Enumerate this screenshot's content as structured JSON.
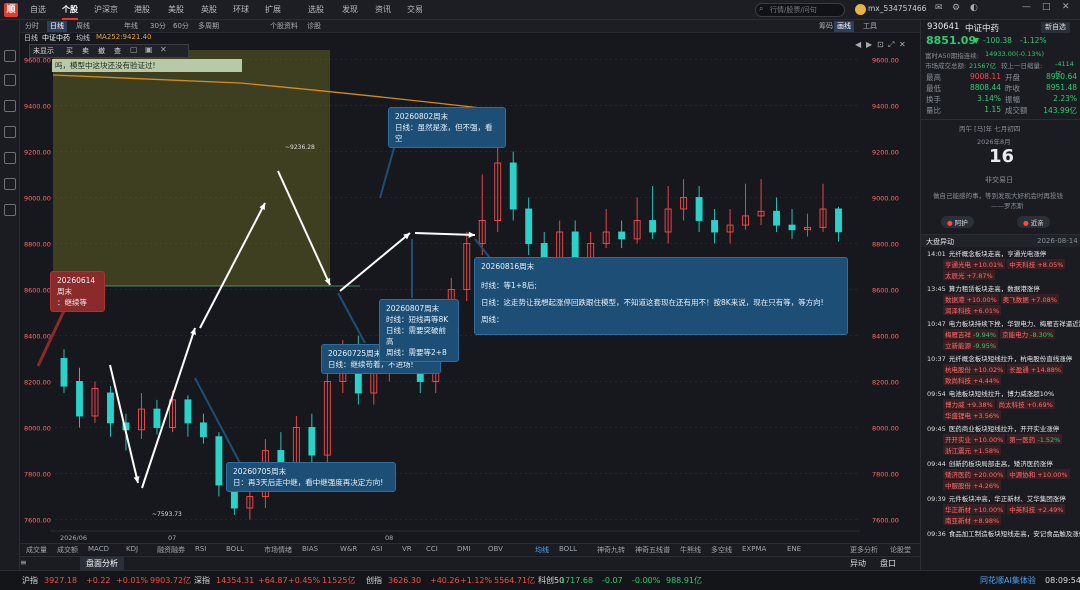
{
  "topnav": {
    "items": [
      "自选",
      "个股",
      "沪深京",
      "港股",
      "美股",
      "英股",
      "环球",
      "扩展",
      "选股",
      "发现",
      "资讯",
      "交易"
    ],
    "active": 1,
    "search_placeholder": "行情/股票/问句",
    "user": "mx_534757466"
  },
  "tb2": {
    "items": [
      "分时",
      "日线",
      "周线",
      "年线",
      "30分",
      "60分",
      "多周期",
      "个股资料",
      "诊股"
    ],
    "active": 1,
    "right": [
      "筹码",
      "画线",
      "工具"
    ]
  },
  "tb3": {
    "label1": "日线",
    "label2": "中证中药",
    "label3": "均线",
    "ma": "MA252:9421.40"
  },
  "draw_toolbar": [
    "未显示",
    "买",
    "卖",
    "撤",
    "查"
  ],
  "top_note": "吗，模型中这块还没有验证过!",
  "yaxis": [
    "9600.00",
    "9400.00",
    "9200.00",
    "9000.00",
    "8800.00",
    "8600.00",
    "8400.00",
    "8200.00",
    "8000.00",
    "7800.00",
    "7600.00"
  ],
  "xaxis": [
    "2026/06",
    "07",
    "08"
  ],
  "high_label": "~9236.28",
  "low_label": "~7593.73",
  "notes": {
    "n1": {
      "title": "20260614周末",
      "line": "：继续等"
    },
    "n2": {
      "title": "20260705周末",
      "line": "日：再3天后走中继，看中继强度再决定方向!"
    },
    "n3": {
      "title": "20260725周末",
      "line": "日线：继续苟着，不进场!"
    },
    "n4": {
      "title": "20260802周末",
      "line": "日线：虽然是涨，但不强，看空"
    },
    "n5": {
      "title": "20260807周末",
      "l1": "时线：短线再等8K",
      "l2": "日线：需要突破前高",
      "l3": "周线：需要等2+8"
    },
    "n6": {
      "title": "20260816周末",
      "l1": "时线：等1+8后;",
      "l2": "日线：这走势让我想起涨停回跌跟住模型，不知道这套现在还有用不！按8K来说，现在只有等，等方向!",
      "l3": "周线："
    }
  },
  "indicators": [
    "成交量",
    "成交额",
    "MACD",
    "KDJ",
    "融资融券",
    "RSI",
    "BOLL",
    "市场情绪",
    "BIAS",
    "W&R",
    "ASI",
    "VR",
    "CCI",
    "DMI",
    "OBV"
  ],
  "ind2": [
    "均线",
    "BOLL",
    "神奇九转",
    "神奇五线谱",
    "牛熊线",
    "多空线",
    "EXPMA",
    "ENE"
  ],
  "ind_right": [
    "更多分析",
    "论股堂"
  ],
  "panel": {
    "code": "930641",
    "name": "中证中药",
    "btn": "新自选",
    "price": "8851.09",
    "arrow": "▼",
    "chg": "-100.38",
    "pct": "-1.12%",
    "r1l": "富时A50期指连续:",
    "r1v": "14933.00(-0.13%)",
    "r2l": "市场成交总额:",
    "r2v": "21567亿",
    "r2l2": "较上一日缩量:",
    "r2v2": "-4114亿",
    "stats": [
      [
        "最高",
        "9008.11",
        "开盘",
        "8920.64"
      ],
      [
        "最低",
        "8808.44",
        "昨收",
        "8951.48"
      ],
      [
        "换手",
        "3.14%",
        "振幅",
        "2.23%"
      ],
      [
        "量比",
        "1.15",
        "成交额",
        "143.99亿"
      ]
    ],
    "cal_head": "丙午 [马]年 七月初四",
    "cal_month": "2026年8月",
    "cal_day": "16",
    "cal_status": "非交易日",
    "quote": "做自己能感的事，等到发现大好机会时再投钱",
    "author": "——罗杰斯",
    "btn_a": "阿护",
    "btn_b": "近亲",
    "news_head": "大盘异动",
    "news_date": "2026-08-14",
    "news": [
      {
        "t": "14:01",
        "h": "光纤概念板块走高，亨通光电涨停",
        "s": [
          [
            "亨通光电",
            "+10.01%"
          ],
          [
            "中天科技",
            "+8.05%"
          ],
          [
            "太辰光",
            "+7.87%"
          ]
        ]
      },
      {
        "t": "13:45",
        "h": "算力租赁板块走高，数据港涨停",
        "s": [
          [
            "数据港",
            "+10.00%"
          ],
          [
            "奥飞数据",
            "+7.08%"
          ],
          [
            "润泽科技",
            "+6.01%"
          ]
        ]
      },
      {
        "t": "10:47",
        "h": "电力板块持续下挫，华银电力、梅雁吉祥逼近跌停",
        "s": [
          [
            "梅雁吉祥",
            "-9.94%"
          ],
          [
            "京能电力",
            "-8.30%"
          ],
          [
            "立新能源",
            "-9.95%"
          ]
        ]
      },
      {
        "t": "10:37",
        "h": "光纤概念板块短线拉升，杭电股份直线涨停",
        "s": [
          [
            "杭电股份",
            "+10.02%"
          ],
          [
            "长盈通",
            "+14.88%"
          ],
          [
            "致尚科技",
            "+4.44%"
          ]
        ]
      },
      {
        "t": "09:54",
        "h": "电池板块短线拉升，博力威涨超10%",
        "s": [
          [
            "博力威",
            "+9.38%"
          ],
          [
            "尚太科技",
            "+0.69%"
          ],
          [
            "华盛锂电",
            "+3.56%"
          ]
        ]
      },
      {
        "t": "09:45",
        "h": "医药商业板块短线拉升，开开实业涨停",
        "s": [
          [
            "开开实业",
            "+10.00%"
          ],
          [
            "第一医药",
            "-1.52%"
          ],
          [
            "浙江震元",
            "+1.58%"
          ]
        ]
      },
      {
        "t": "09:44",
        "h": "创新药板块局部走高，矮济医药涨停",
        "s": [
          [
            "矮济医药",
            "+20.00%"
          ],
          [
            "中源协和",
            "+10.00%"
          ],
          [
            "中服股份",
            "+4.26%"
          ]
        ]
      },
      {
        "t": "09:39",
        "h": "元件板块冲高，华正新材、艾华集团涨停",
        "s": [
          [
            "华正新材",
            "+10.00%"
          ],
          [
            "中英科技",
            "+2.49%"
          ],
          [
            "南亚新材",
            "+8.98%"
          ]
        ]
      },
      {
        "t": "09:36",
        "h": "食品加工制造板块短线走高，安记食品触及涨停",
        "s": []
      }
    ],
    "tabs": [
      "异动",
      "盘口"
    ]
  },
  "status": [
    {
      "n": "沪指",
      "v": "3927.18",
      "c": "+0.22",
      "p": "+0.01%",
      "a": "9903.72亿",
      "col": "red"
    },
    {
      "n": "深指",
      "v": "14354.31",
      "c": "+64.87",
      "p": "+0.45%",
      "a": "11525亿",
      "col": "red"
    },
    {
      "n": "创指",
      "v": "3626.30",
      "c": "+40.26",
      "p": "+1.12%",
      "a": "5564.71亿",
      "col": "red"
    },
    {
      "n": "科创50",
      "v": "1717.68",
      "c": "-0.07",
      "p": "-0.00%",
      "a": "988.91亿",
      "col": "green"
    }
  ],
  "status_right": "同花顺AI集体验",
  "time": "08:09:54",
  "chart_data": {
    "type": "candlestick",
    "ylim": [
      7550,
      9650
    ],
    "ma252": 9421.4,
    "high": 9236.28,
    "low": 7593.73,
    "candles": [
      [
        8300,
        8180,
        8340,
        8150
      ],
      [
        8200,
        8050,
        8260,
        8000
      ],
      [
        8050,
        8170,
        8200,
        8020
      ],
      [
        8150,
        8020,
        8180,
        7960
      ],
      [
        8020,
        7990,
        8060,
        7900
      ],
      [
        7990,
        8080,
        8150,
        7950
      ],
      [
        8080,
        8000,
        8120,
        7970
      ],
      [
        8000,
        8120,
        8160,
        7980
      ],
      [
        8120,
        8020,
        8140,
        7960
      ],
      [
        8020,
        7960,
        8060,
        7930
      ],
      [
        7960,
        7750,
        7980,
        7700
      ],
      [
        7750,
        7650,
        7780,
        7620
      ],
      [
        7650,
        7700,
        7760,
        7600
      ],
      [
        7700,
        7900,
        7950,
        7650
      ],
      [
        7900,
        7800,
        7980,
        7760
      ],
      [
        7800,
        8000,
        8050,
        7760
      ],
      [
        8000,
        7880,
        8060,
        7850
      ],
      [
        7880,
        8200,
        8250,
        7850
      ],
      [
        8200,
        8350,
        8380,
        8150
      ],
      [
        8350,
        8150,
        8400,
        8100
      ],
      [
        8150,
        8250,
        8320,
        8100
      ],
      [
        8250,
        8450,
        8500,
        8200
      ],
      [
        8450,
        8300,
        8480,
        8250
      ],
      [
        8300,
        8200,
        8350,
        8150
      ],
      [
        8200,
        8400,
        8450,
        8150
      ],
      [
        8400,
        8600,
        8650,
        8350
      ],
      [
        8600,
        8800,
        8850,
        8550
      ],
      [
        8800,
        8900,
        9100,
        8750
      ],
      [
        8900,
        9150,
        9236,
        8850
      ],
      [
        9150,
        8950,
        9200,
        8900
      ],
      [
        8950,
        8800,
        9000,
        8750
      ],
      [
        8800,
        8700,
        8850,
        8650
      ],
      [
        8700,
        8850,
        8900,
        8650
      ],
      [
        8850,
        8650,
        8900,
        8600
      ],
      [
        8650,
        8800,
        8850,
        8620
      ],
      [
        8800,
        8850,
        8950,
        8780
      ],
      [
        8850,
        8820,
        8900,
        8780
      ],
      [
        8820,
        8900,
        9000,
        8800
      ],
      [
        8900,
        8850,
        9050,
        8820
      ],
      [
        8850,
        8950,
        9050,
        8800
      ],
      [
        8950,
        9000,
        9080,
        8900
      ],
      [
        9000,
        8900,
        9050,
        8850
      ],
      [
        8900,
        8850,
        8950,
        8800
      ],
      [
        8850,
        8880,
        8950,
        8800
      ],
      [
        8880,
        8920,
        9060,
        8860
      ],
      [
        8920,
        8940,
        9080,
        8880
      ],
      [
        8940,
        8880,
        9000,
        8850
      ],
      [
        8880,
        8860,
        8950,
        8820
      ],
      [
        8860,
        8870,
        8930,
        8830
      ],
      [
        8870,
        8950,
        9060,
        8850
      ],
      [
        8950,
        8851,
        8960,
        8808
      ]
    ]
  }
}
